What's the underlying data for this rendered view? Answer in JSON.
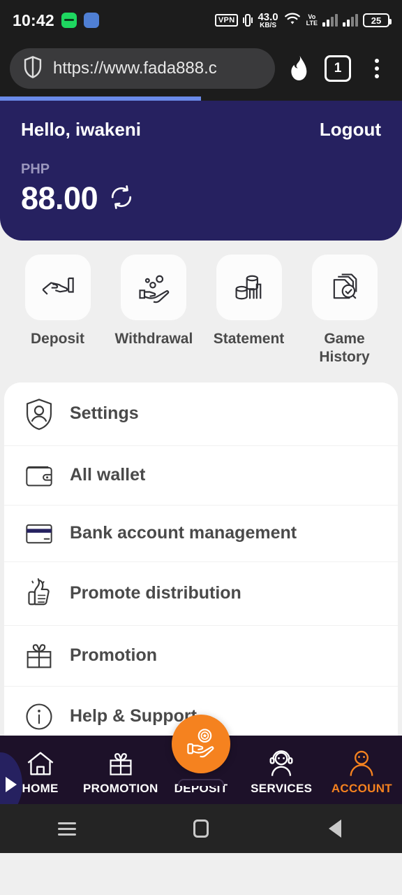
{
  "statusbar": {
    "time": "10:42",
    "icons": [
      "spotify-icon",
      "blue-app-icon"
    ],
    "vpn": "VPN",
    "vibrate": "vibrate-icon",
    "net_speed_value": "43.0",
    "net_speed_unit": "KB/S",
    "wifi": "wifi-icon",
    "volte_top": "Vo",
    "volte_bottom": "LTE",
    "battery": "25"
  },
  "browser": {
    "url": "https://www.fada888.c",
    "shield": "shield-icon",
    "flame": "flame-icon",
    "tab_count": "1",
    "menu": "three-dot-menu-icon",
    "progress_percent": 50
  },
  "account_header": {
    "greeting": "Hello, iwakeni",
    "logout_label": "Logout",
    "currency": "PHP",
    "balance": "88.00",
    "refresh_icon": "refresh-icon",
    "bg_color": "#262160"
  },
  "quick_actions": [
    {
      "label": "Deposit",
      "icon": "hand-card-icon"
    },
    {
      "label": "Withdrawal",
      "icon": "hand-coins-icon"
    },
    {
      "label": "Statement",
      "icon": "coins-chart-icon"
    },
    {
      "label": "Game History",
      "icon": "documents-clock-icon"
    }
  ],
  "menu_items": [
    {
      "label": "Settings",
      "icon": "shield-user-icon"
    },
    {
      "label": "All wallet",
      "icon": "wallet-icon"
    },
    {
      "label": "Bank account management",
      "icon": "credit-card-icon"
    },
    {
      "label": "Promote distribution",
      "icon": "thumbs-up-icon"
    },
    {
      "label": "Promotion",
      "icon": "gift-icon"
    },
    {
      "label": "Help & Support",
      "icon": "info-circle-icon"
    }
  ],
  "side_tab": {
    "icon": "play-arrow-icon"
  },
  "bottom_nav": {
    "items": [
      {
        "label": "HOME",
        "icon": "home-icon",
        "active": false
      },
      {
        "label": "PROMOTION",
        "icon": "gift-icon",
        "active": false
      },
      {
        "label": "DEPOSIT",
        "icon": "hand-coin-icon",
        "active": false,
        "fab": true
      },
      {
        "label": "SERVICES",
        "icon": "headset-support-icon",
        "active": false
      },
      {
        "label": "ACCOUNT",
        "icon": "user-icon",
        "active": true
      }
    ],
    "bg_color": "#1d1129",
    "accent_color": "#f5821f"
  },
  "android_nav": {
    "recents": "hamburger-recents-icon",
    "home": "square-home-icon",
    "back": "triangle-back-icon"
  }
}
